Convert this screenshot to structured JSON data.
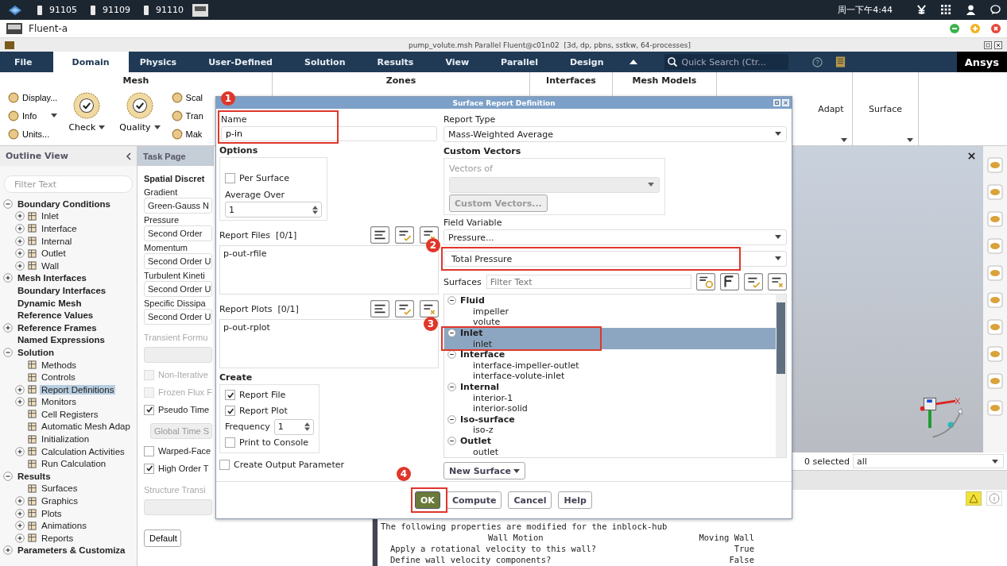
{
  "taskbar": {
    "tasks": [
      "91105",
      "91109",
      "91110"
    ],
    "clock": "周一下午4:44"
  },
  "app": {
    "title": "Fluent-a"
  },
  "window": {
    "title": "pump_volute.msh Parallel Fluent@c01n02  [3d, dp, pbns, sstkw, 64-processes]"
  },
  "menu": {
    "tabs": [
      {
        "label": "File",
        "selected": false
      },
      {
        "label": "Domain",
        "selected": true
      },
      {
        "label": "Physics",
        "selected": false
      },
      {
        "label": "User-Defined",
        "selected": false
      },
      {
        "label": "Solution",
        "selected": false
      },
      {
        "label": "Results",
        "selected": false
      },
      {
        "label": "View",
        "selected": false
      },
      {
        "label": "Parallel",
        "selected": false
      },
      {
        "label": "Design",
        "selected": false
      }
    ],
    "search": {
      "placeholder": "Quick Search (Ctr..."
    },
    "logo": "Ansys"
  },
  "ribbon": {
    "groups": [
      {
        "kind": "header",
        "title": "Mesh",
        "columns": [
          {
            "kind": "stack",
            "items": [
              {
                "label": "Display...",
                "dropdown": false
              },
              {
                "label": "Info",
                "dropdown": true
              },
              {
                "label": "Units...",
                "dropdown": false
              }
            ]
          },
          {
            "kind": "large",
            "label": "Check",
            "dropdown": true
          },
          {
            "kind": "large",
            "label": "Quality",
            "dropdown": true
          },
          {
            "kind": "stack",
            "items": [
              {
                "label": "Scal",
                "dropdown": false
              },
              {
                "label": "Tran",
                "dropdown": false
              },
              {
                "label": "Mak",
                "dropdown": false
              }
            ]
          }
        ]
      },
      {
        "kind": "header",
        "title": "Zones"
      },
      {
        "kind": "header",
        "title": "Interfaces"
      },
      {
        "kind": "header",
        "title": "Mesh Models"
      },
      {
        "kind": "collapsed",
        "title": "Adapt"
      },
      {
        "kind": "collapsed",
        "title": "Surface"
      }
    ]
  },
  "outline": {
    "title": "Outline View",
    "filter_placeholder": "Filter Text",
    "tree": [
      {
        "children": [
          {
            "label": "Boundary Conditions",
            "expanded": true,
            "selected": false,
            "children": [
              {
                "label": "Inlet",
                "expanded": false,
                "selected": false
              },
              {
                "label": "Interface",
                "expanded": false,
                "selected": false
              },
              {
                "label": "Internal",
                "expanded": false,
                "selected": false
              },
              {
                "label": "Outlet",
                "expanded": false,
                "selected": false
              },
              {
                "label": "Wall",
                "expanded": false,
                "selected": false
              }
            ]
          },
          {
            "label": "Mesh Interfaces",
            "expanded": false,
            "selected": false
          },
          {
            "label": "Boundary Interfaces",
            "selected": false
          },
          {
            "label": "Dynamic Mesh",
            "selected": false
          },
          {
            "label": "Reference Values",
            "selected": false
          },
          {
            "label": "Reference Frames",
            "expanded": false,
            "selected": false
          },
          {
            "label": "Named Expressions",
            "selected": false
          }
        ]
      },
      {
        "label": "Solution",
        "expanded": true,
        "selected": false,
        "children": [
          {
            "label": "Methods",
            "selected": false
          },
          {
            "label": "Controls",
            "selected": false
          },
          {
            "label": "Report Definitions",
            "expanded": false,
            "selected": true
          },
          {
            "label": "Monitors",
            "expanded": false,
            "selected": false
          },
          {
            "label": "Cell Registers",
            "selected": false
          },
          {
            "label": "Automatic Mesh Adap",
            "selected": false
          },
          {
            "label": "Initialization",
            "selected": false
          },
          {
            "label": "Calculation Activities",
            "expanded": false,
            "selected": false
          },
          {
            "label": "Run Calculation",
            "selected": false
          }
        ]
      },
      {
        "label": "Results",
        "expanded": true,
        "selected": false,
        "children": [
          {
            "label": "Surfaces",
            "selected": false
          },
          {
            "label": "Graphics",
            "expanded": false,
            "selected": false
          },
          {
            "label": "Plots",
            "expanded": false,
            "selected": false
          },
          {
            "label": "Animations",
            "expanded": false,
            "selected": false
          },
          {
            "label": "Reports",
            "expanded": false,
            "selected": false
          }
        ]
      },
      {
        "label": "Parameters & Customiza",
        "expanded": false,
        "selected": false
      }
    ]
  },
  "task_page": {
    "title": "Task Page",
    "section": "Spatial Discret",
    "items": [
      {
        "kind": "select",
        "label": "Gradient",
        "value": "Green-Gauss N",
        "disabled": false
      },
      {
        "kind": "select",
        "label": "Pressure",
        "value": "Second Order",
        "disabled": false
      },
      {
        "kind": "select",
        "label": "Momentum",
        "value": "Second Order U",
        "disabled": false
      },
      {
        "kind": "select",
        "label": "Turbulent Kineti",
        "value": "Second Order U",
        "disabled": false
      },
      {
        "kind": "select",
        "label": "Specific Dissipa",
        "value": "Second Order U",
        "disabled": false
      },
      {
        "kind": "select",
        "label": "Transient Formu",
        "disabled": true
      },
      {
        "kind": "checkbox",
        "label": "Non-Iterative",
        "checked": false,
        "disabled": true
      },
      {
        "kind": "checkbox",
        "label": "Frozen Flux F",
        "checked": false,
        "disabled": true
      },
      {
        "kind": "checkbox",
        "label": "Pseudo Time",
        "checked": true,
        "disabled": false
      },
      {
        "kind": "select",
        "value": "Global Time S",
        "disabled": true
      },
      {
        "kind": "checkbox",
        "label": "Warped-Face",
        "checked": false,
        "disabled": false
      },
      {
        "kind": "checkbox",
        "label": "High Order T",
        "checked": true,
        "disabled": false
      },
      {
        "kind": "select",
        "label": "Structure Transi",
        "disabled": true
      }
    ],
    "button": "Default"
  },
  "graphics": {
    "selected_count": "0 selected",
    "filter": "all"
  },
  "console": {
    "lines": [
      {
        "text": "The following properties are modified for the inblock-hub"
      },
      {
        "text": "Wall Motion",
        "value": "Moving Wall"
      },
      {
        "text": "Apply a rotational velocity to this wall?",
        "value": "True"
      },
      {
        "text": "Define wall velocity components?",
        "value": "False"
      }
    ]
  },
  "dialog": {
    "title": "Surface Report Definition",
    "name": {
      "label": "Name",
      "value": "p-in",
      "annotation": "1"
    },
    "options": {
      "title": "Options",
      "per_surface": {
        "label": "Per Surface",
        "checked": false
      },
      "average_over": {
        "label": "Average Over",
        "value": "1"
      }
    },
    "report_files": {
      "label": "Report Files  [0/1]",
      "items": [
        "p-out-rfile"
      ]
    },
    "report_plots": {
      "label": "Report Plots  [0/1]",
      "items": [
        "p-out-rplot"
      ]
    },
    "create": {
      "title": "Create",
      "report_file": {
        "label": "Report File",
        "checked": true
      },
      "report_plot": {
        "label": "Report Plot",
        "checked": true
      },
      "frequency": {
        "label": "Frequency",
        "value": "1"
      },
      "print_to_console": {
        "label": "Print to Console",
        "checked": false
      }
    },
    "create_output_parameter": {
      "label": "Create Output Parameter",
      "checked": false
    },
    "report_type": {
      "label": "Report Type",
      "value": "Mass-Weighted Average"
    },
    "custom_vectors": {
      "title": "Custom Vectors",
      "vectors_of": "Vectors of",
      "button": "Custom Vectors..."
    },
    "field_variable": {
      "label": "Field Variable",
      "category": "Pressure...",
      "value": "Total Pressure",
      "annotation": "2"
    },
    "surfaces": {
      "label": "Surfaces",
      "placeholder": "Filter Text",
      "annotation": "3",
      "groups": [
        {
          "label": "Fluid",
          "expanded": true,
          "selected": false,
          "items": [
            {
              "label": "impeller",
              "selected": false
            },
            {
              "label": "volute",
              "selected": false
            }
          ]
        },
        {
          "label": "Inlet",
          "expanded": true,
          "selected": true,
          "items": [
            {
              "label": "inlet",
              "selected": true
            }
          ]
        },
        {
          "label": "Interface",
          "expanded": true,
          "selected": false,
          "items": [
            {
              "label": "interface-impeller-outlet",
              "selected": false
            },
            {
              "label": "interface-volute-inlet",
              "selected": false
            }
          ]
        },
        {
          "label": "Internal",
          "expanded": true,
          "selected": false,
          "items": [
            {
              "label": "interior-1",
              "selected": false
            },
            {
              "label": "interior-solid",
              "selected": false
            }
          ]
        },
        {
          "label": "Iso-surface",
          "expanded": true,
          "selected": false,
          "items": [
            {
              "label": "iso-z",
              "selected": false
            }
          ]
        },
        {
          "label": "Outlet",
          "expanded": true,
          "selected": false,
          "items": [
            {
              "label": "outlet",
              "selected": false
            }
          ]
        }
      ]
    },
    "new_surface": "New Surface",
    "buttons": [
      {
        "label": "OK",
        "kind": "primary",
        "annotation": "4"
      },
      {
        "label": "Compute",
        "kind": "normal"
      },
      {
        "label": "Cancel",
        "kind": "normal"
      },
      {
        "label": "Help",
        "kind": "normal"
      }
    ]
  }
}
